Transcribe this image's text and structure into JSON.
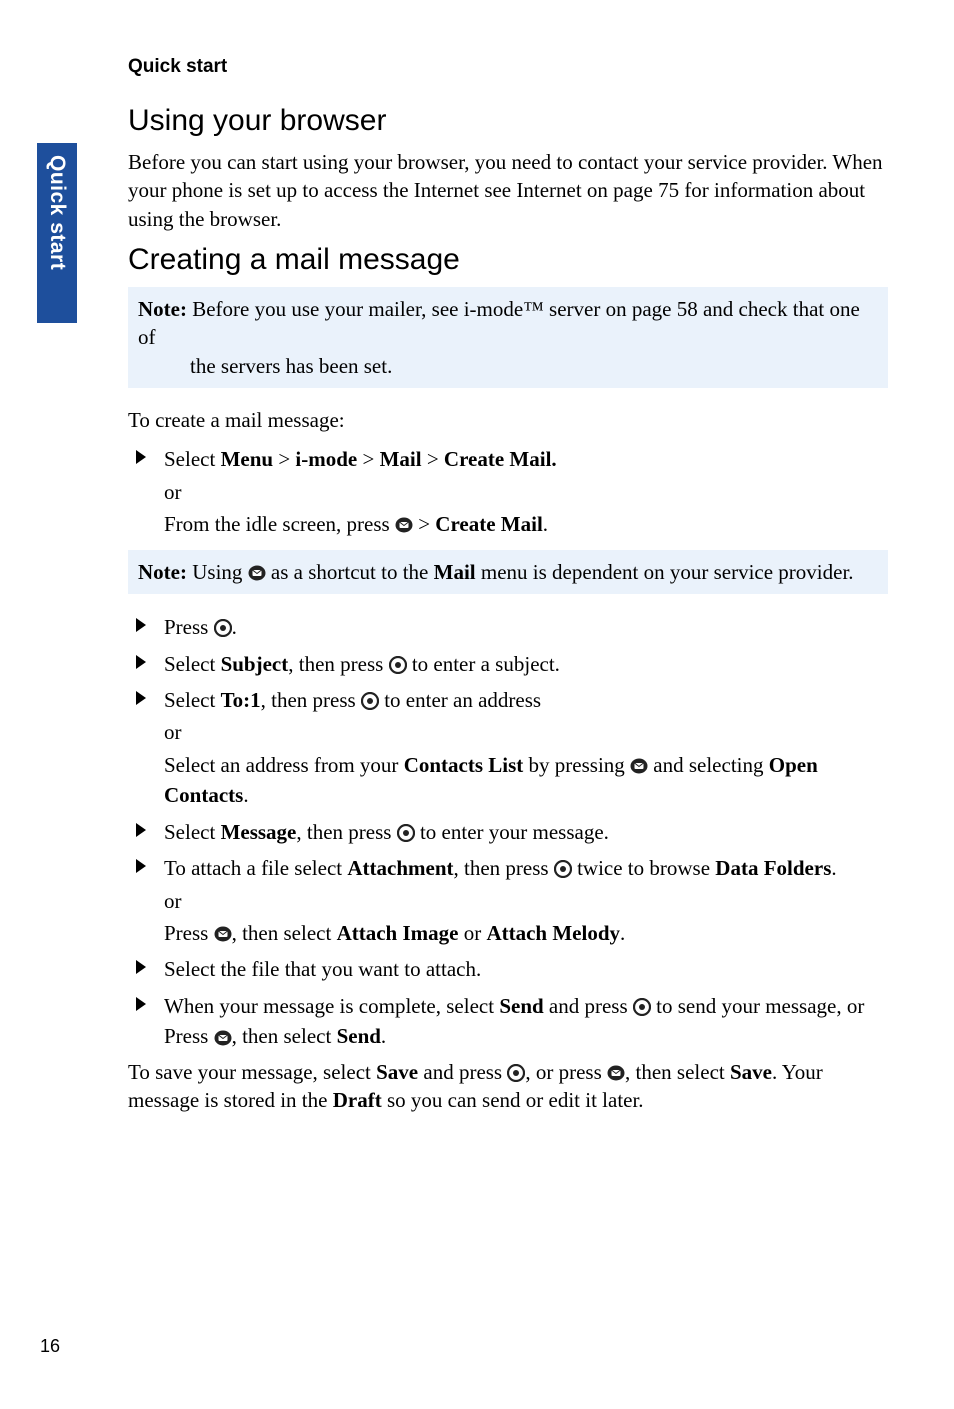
{
  "sidebar": {
    "label": "Quick start"
  },
  "running_head": "Quick start",
  "page_number": "16",
  "section_browser": {
    "title": "Using your browser",
    "body": "Before you can start using your browser, you need to contact your service provider. When your phone is set up to access the Internet see Internet on page 75 for information about using the browser."
  },
  "section_mail": {
    "title": "Creating a mail message",
    "note1_label": "Note:",
    "note1_line1": " Before you use your mailer, see i-mode™ server on page 58 and check that one of ",
    "note1_line2": "the servers has been set.",
    "intro": "To create a mail message:",
    "step1_a": "Select ",
    "step1_menu": "Menu",
    "step1_gt1": " > ",
    "step1_imode": "i-mode",
    "step1_gt2": " > ",
    "step1_mail": "Mail",
    "step1_gt3": " > ",
    "step1_create": "Create Mail.",
    "step1_or": "or",
    "step1_b_pre": "From the idle screen, press",
    "step1_b_gt": " > ",
    "step1_b_create": "Create Mail",
    "step1_b_period": ".",
    "note2_label": "Note:",
    "note2_pre": " Using",
    "note2_mid": " as a shortcut to the ",
    "note2_mail": "Mail",
    "note2_post": " menu is dependent on your service provider.",
    "step2_pre": "Press",
    "step2_post": ".",
    "step3_pre": "Select ",
    "step3_subject": "Subject",
    "step3_mid": ", then press",
    "step3_post": " to enter a subject.",
    "step4_pre": "Select ",
    "step4_to": "To:1",
    "step4_mid": ", then press",
    "step4_post": " to enter an address",
    "step4_or": "or",
    "step4b_pre": "Select an address from your ",
    "step4b_cl": "Contacts List",
    "step4b_mid": " by pressing",
    "step4b_mid2": " and selecting ",
    "step4b_open": "Open Contacts",
    "step4b_post": ".",
    "step5_pre": "Select ",
    "step5_msg": "Message",
    "step5_mid": ", then press",
    "step5_post": " to enter your message.",
    "step6_pre": "To attach a file select ",
    "step6_att": "Attachment",
    "step6_mid": ", then press",
    "step6_mid2": " twice to browse ",
    "step6_df": "Data Folders",
    "step6_post": ".",
    "step6_or": "or",
    "step6b_pre": "Press",
    "step6b_mid": ", then select ",
    "step6b_ai": "Attach Image",
    "step6b_or": " or ",
    "step6b_am": "Attach Melody",
    "step6b_post": ".",
    "step7": "Select the file that you want to attach.",
    "step8_pre": "When your message is complete, select ",
    "step8_send": "Send",
    "step8_mid": " and press",
    "step8_post": " to send your message, or Press",
    "step8_mid2": ", then select ",
    "step8_send2": "Send",
    "step8_post2": ".",
    "closing_pre": "To save your message, select ",
    "closing_save": "Save",
    "closing_mid": " and press",
    "closing_mid2": ", or press",
    "closing_mid3": ", then select ",
    "closing_save2": "Save",
    "closing_mid4": ". Your message is stored in the ",
    "closing_draft": "Draft",
    "closing_post": " so you can send or edit it later."
  }
}
